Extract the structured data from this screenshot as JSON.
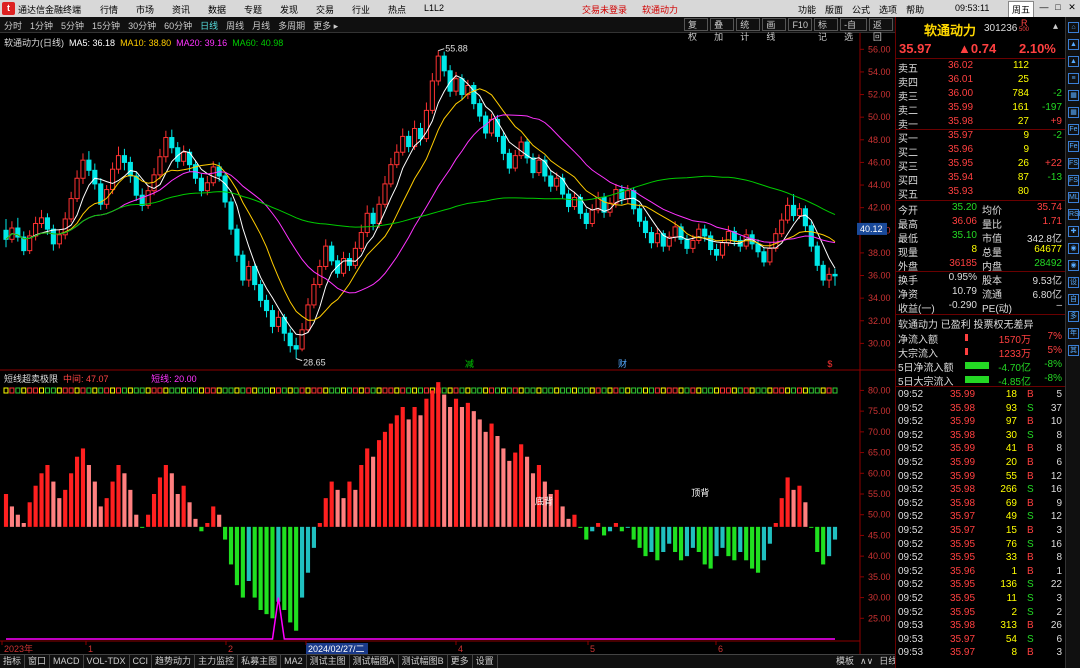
{
  "titlebar": {
    "logo": "t",
    "app": "通达信金融终端",
    "menu": [
      "行情",
      "市场",
      "资讯",
      "数据",
      "专题",
      "发现",
      "交易",
      "行业",
      "热点",
      "L1L2"
    ],
    "alert": "交易未登录",
    "alert2": "软通动力",
    "right": [
      "功能",
      "版面",
      "公式",
      "选项",
      "帮助"
    ],
    "clock": "09:53:11",
    "weekday": "周五",
    "window_buttons": [
      "—",
      "□",
      "✕"
    ]
  },
  "toolbar": {
    "tabs": [
      "分时",
      "1分钟",
      "5分钟",
      "15分钟",
      "30分钟",
      "60分钟",
      "日线",
      "周线",
      "月线",
      "多周期",
      "更多 ▸"
    ],
    "active": "日线",
    "right": [
      "复权",
      "叠加",
      "统计",
      "画线",
      "F10",
      "标记",
      "-自选",
      "返回"
    ]
  },
  "main_legend": {
    "name": "软通动力(日线)",
    "ma5": "MA5: 36.18",
    "ma10": "MA10: 38.80",
    "ma20": "MA20: 39.16",
    "ma60": "MA60: 40.98"
  },
  "sub_legend": {
    "name": "短线超卖极限",
    "mid": "中间: 47.07",
    "line": "短线: 20.00"
  },
  "chart_data": {
    "type": "candlestick",
    "y_axis_main": {
      "ticks": [
        56.0,
        54.0,
        52.0,
        50.0,
        48.0,
        46.0,
        44.0,
        42.0,
        40.0,
        38.0,
        36.0,
        34.0,
        32.0,
        30.0
      ],
      "range": [
        28.0,
        57.0
      ]
    },
    "y_axis_sub": {
      "ticks": [
        80.0,
        75.0,
        70.0,
        65.0,
        60.0,
        55.0,
        50.0,
        45.0,
        40.0,
        35.0,
        30.0,
        25.0
      ],
      "range": [
        20.0,
        83.0
      ]
    },
    "annotations": {
      "high": "55.88",
      "low": "28.65",
      "current_price_tag": "40.12",
      "sub_labels": [
        "底背",
        "顶背"
      ],
      "event_flags": [
        "减",
        "财",
        "$"
      ]
    },
    "x_axis_labels": [
      "2023年",
      "1",
      "2",
      "2024/02/27/二",
      "4",
      "5",
      "6"
    ],
    "bars": [
      [
        40.0,
        39.2,
        41.0,
        38.5
      ],
      [
        39.2,
        40.2,
        40.8,
        38.9
      ],
      [
        40.2,
        39.4,
        41.1,
        39.0
      ],
      [
        39.4,
        38.2,
        39.9,
        37.8
      ],
      [
        38.2,
        39.5,
        40.0,
        37.9
      ],
      [
        39.5,
        40.6,
        41.2,
        39.1
      ],
      [
        40.6,
        41.1,
        41.8,
        40.2
      ],
      [
        41.1,
        40.1,
        41.5,
        39.6
      ],
      [
        40.1,
        38.8,
        40.5,
        38.2
      ],
      [
        38.8,
        39.6,
        40.1,
        38.4
      ],
      [
        39.6,
        41.0,
        41.6,
        39.2
      ],
      [
        41.0,
        42.8,
        43.4,
        40.7
      ],
      [
        42.8,
        44.6,
        45.3,
        42.5
      ],
      [
        44.6,
        46.2,
        46.8,
        44.1
      ],
      [
        46.2,
        45.3,
        47.0,
        44.8
      ],
      [
        45.3,
        44.1,
        45.9,
        43.6
      ],
      [
        44.1,
        42.3,
        44.6,
        41.8
      ],
      [
        42.3,
        43.6,
        44.0,
        41.9
      ],
      [
        43.6,
        45.4,
        46.0,
        43.2
      ],
      [
        45.4,
        46.6,
        47.4,
        45.0
      ],
      [
        46.6,
        46.0,
        47.2,
        45.3
      ],
      [
        46.0,
        44.8,
        46.5,
        44.2
      ],
      [
        44.8,
        43.1,
        45.2,
        42.6
      ],
      [
        43.1,
        42.2,
        43.7,
        41.7
      ],
      [
        42.2,
        43.5,
        44.0,
        41.9
      ],
      [
        43.5,
        44.9,
        45.5,
        43.1
      ],
      [
        44.9,
        46.5,
        47.2,
        44.5
      ],
      [
        46.5,
        48.2,
        48.8,
        46.0
      ],
      [
        48.2,
        47.3,
        48.9,
        46.8
      ],
      [
        47.3,
        46.1,
        47.8,
        45.5
      ],
      [
        46.1,
        46.9,
        47.5,
        45.7
      ],
      [
        46.9,
        45.8,
        47.2,
        45.2
      ],
      [
        45.8,
        44.6,
        46.2,
        44.1
      ],
      [
        44.6,
        43.5,
        45.0,
        43.0
      ],
      [
        43.5,
        44.2,
        44.8,
        43.1
      ],
      [
        44.2,
        45.6,
        46.1,
        43.9
      ],
      [
        45.6,
        44.8,
        46.0,
        44.3
      ],
      [
        44.8,
        42.5,
        45.1,
        42.0
      ],
      [
        42.5,
        40.1,
        42.9,
        39.6
      ],
      [
        40.1,
        37.8,
        40.5,
        37.2
      ],
      [
        37.8,
        35.6,
        38.2,
        35.1
      ],
      [
        35.6,
        36.8,
        37.3,
        35.0
      ],
      [
        36.8,
        35.2,
        37.1,
        34.7
      ],
      [
        35.2,
        33.8,
        35.6,
        33.2
      ],
      [
        33.8,
        32.9,
        34.3,
        32.3
      ],
      [
        32.9,
        31.5,
        33.4,
        30.9
      ],
      [
        31.5,
        32.3,
        32.9,
        31.0
      ],
      [
        32.3,
        30.9,
        32.6,
        30.2
      ],
      [
        30.9,
        29.8,
        31.3,
        29.2
      ],
      [
        29.8,
        29.5,
        30.5,
        28.65
      ],
      [
        29.5,
        31.2,
        31.8,
        29.3
      ],
      [
        31.2,
        33.4,
        34.0,
        31.0
      ],
      [
        33.4,
        35.2,
        35.8,
        33.1
      ],
      [
        35.2,
        36.8,
        37.4,
        34.9
      ],
      [
        36.8,
        38.6,
        39.2,
        36.5
      ],
      [
        38.6,
        37.3,
        39.0,
        36.9
      ],
      [
        37.3,
        36.2,
        37.8,
        35.8
      ],
      [
        36.2,
        37.5,
        38.1,
        35.9
      ],
      [
        37.5,
        36.9,
        38.0,
        36.4
      ],
      [
        36.9,
        38.4,
        39.0,
        36.6
      ],
      [
        38.4,
        39.8,
        40.5,
        38.1
      ],
      [
        39.8,
        41.5,
        42.2,
        39.4
      ],
      [
        41.5,
        40.6,
        42.0,
        40.0
      ],
      [
        40.6,
        42.3,
        43.0,
        40.2
      ],
      [
        42.3,
        44.1,
        44.8,
        42.0
      ],
      [
        44.1,
        45.8,
        46.4,
        43.8
      ],
      [
        45.8,
        46.9,
        47.6,
        45.5
      ],
      [
        46.9,
        48.3,
        49.0,
        46.6
      ],
      [
        48.3,
        47.4,
        48.8,
        46.9
      ],
      [
        47.4,
        49.0,
        49.7,
        47.1
      ],
      [
        49.0,
        48.1,
        49.5,
        47.5
      ],
      [
        48.1,
        50.6,
        51.3,
        47.8
      ],
      [
        50.6,
        53.2,
        53.9,
        50.3
      ],
      [
        53.2,
        55.4,
        55.88,
        52.8
      ],
      [
        55.4,
        54.1,
        55.8,
        53.6
      ],
      [
        54.1,
        52.3,
        54.6,
        51.8
      ],
      [
        52.3,
        53.4,
        54.0,
        51.9
      ],
      [
        53.4,
        52.0,
        53.8,
        51.5
      ],
      [
        52.0,
        52.8,
        53.3,
        51.6
      ],
      [
        52.8,
        51.2,
        53.1,
        50.7
      ],
      [
        51.2,
        50.1,
        51.6,
        49.6
      ],
      [
        50.1,
        48.6,
        50.5,
        48.1
      ],
      [
        48.6,
        49.8,
        50.3,
        48.3
      ],
      [
        49.8,
        48.3,
        50.2,
        47.8
      ],
      [
        48.3,
        46.8,
        48.7,
        46.2
      ],
      [
        46.8,
        45.5,
        47.2,
        45.0
      ],
      [
        45.5,
        46.6,
        47.1,
        45.2
      ],
      [
        46.6,
        47.8,
        48.3,
        46.3
      ],
      [
        47.8,
        46.4,
        48.1,
        45.9
      ],
      [
        46.4,
        45.1,
        46.8,
        44.6
      ],
      [
        45.1,
        46.2,
        46.7,
        44.8
      ],
      [
        46.2,
        44.8,
        46.6,
        44.3
      ],
      [
        44.8,
        43.9,
        45.3,
        43.4
      ],
      [
        43.9,
        44.6,
        45.1,
        43.5
      ],
      [
        44.6,
        43.2,
        45.0,
        42.8
      ],
      [
        43.2,
        42.1,
        43.6,
        41.6
      ],
      [
        42.1,
        42.9,
        43.4,
        41.8
      ],
      [
        42.9,
        41.5,
        43.2,
        41.0
      ],
      [
        41.5,
        40.6,
        41.9,
        40.1
      ],
      [
        40.6,
        41.8,
        42.3,
        40.3
      ],
      [
        41.8,
        42.9,
        43.4,
        41.5
      ],
      [
        42.9,
        41.6,
        43.3,
        41.1
      ],
      [
        41.6,
        42.4,
        42.9,
        41.2
      ],
      [
        42.4,
        43.6,
        44.1,
        42.0
      ],
      [
        43.6,
        42.8,
        44.0,
        42.3
      ],
      [
        42.8,
        43.5,
        44.0,
        42.4
      ],
      [
        43.5,
        41.9,
        43.8,
        41.4
      ],
      [
        41.9,
        40.8,
        42.3,
        40.3
      ],
      [
        40.8,
        39.8,
        41.2,
        39.3
      ],
      [
        39.8,
        38.9,
        40.3,
        38.4
      ],
      [
        38.9,
        39.7,
        40.2,
        38.5
      ],
      [
        39.7,
        38.6,
        40.0,
        38.1
      ],
      [
        38.6,
        39.4,
        39.9,
        38.2
      ],
      [
        39.4,
        40.3,
        40.8,
        39.0
      ],
      [
        40.3,
        39.2,
        40.6,
        38.8
      ],
      [
        39.2,
        38.4,
        39.6,
        37.9
      ],
      [
        38.4,
        39.1,
        39.6,
        38.0
      ],
      [
        39.1,
        40.1,
        40.6,
        38.8
      ],
      [
        40.1,
        39.5,
        40.5,
        39.0
      ],
      [
        39.5,
        38.3,
        39.9,
        37.8
      ],
      [
        38.3,
        37.8,
        38.8,
        37.3
      ],
      [
        37.8,
        38.9,
        39.4,
        37.5
      ],
      [
        38.9,
        39.9,
        40.4,
        38.6
      ],
      [
        39.9,
        39.1,
        40.3,
        38.6
      ],
      [
        39.1,
        38.6,
        39.5,
        38.1
      ],
      [
        38.6,
        39.6,
        40.1,
        38.3
      ],
      [
        39.6,
        38.8,
        40.0,
        38.3
      ],
      [
        38.8,
        38.1,
        39.2,
        37.6
      ],
      [
        38.1,
        37.2,
        38.5,
        36.8
      ],
      [
        37.2,
        38.4,
        38.9,
        36.9
      ],
      [
        38.4,
        39.7,
        40.2,
        38.1
      ],
      [
        39.7,
        40.9,
        41.5,
        39.4
      ],
      [
        40.9,
        42.2,
        42.9,
        40.6
      ],
      [
        42.2,
        41.3,
        43.2,
        40.8
      ],
      [
        41.3,
        41.9,
        42.4,
        41.0
      ],
      [
        41.9,
        40.4,
        42.2,
        39.9
      ],
      [
        40.4,
        38.6,
        40.8,
        38.1
      ],
      [
        38.6,
        36.9,
        39.0,
        36.4
      ],
      [
        36.9,
        35.6,
        37.3,
        35.1
      ],
      [
        35.6,
        36.1,
        36.7,
        34.9
      ],
      [
        36.1,
        35.97,
        36.6,
        35.1
      ]
    ],
    "ma_lines": {
      "ma5": {
        "color": "#ffffff"
      },
      "ma10": {
        "color": "#ffcc00"
      },
      "ma20": {
        "color": "#ff33ff"
      },
      "ma60": {
        "color": "#00cc00"
      }
    },
    "oscillator": [
      55,
      52,
      50,
      48,
      53,
      57,
      60,
      62,
      58,
      54,
      56,
      60,
      64,
      66,
      62,
      58,
      52,
      54,
      58,
      62,
      60,
      56,
      50,
      47,
      50,
      55,
      59,
      62,
      60,
      55,
      57,
      53,
      49,
      46,
      48,
      52,
      50,
      44,
      38,
      33,
      30,
      34,
      30,
      27,
      26,
      25,
      29,
      27,
      24,
      22,
      30,
      36,
      42,
      48,
      54,
      58,
      56,
      54,
      58,
      56,
      62,
      66,
      64,
      68,
      70,
      72,
      74,
      76,
      73,
      76,
      74,
      78,
      80,
      82,
      79,
      76,
      78,
      76,
      77,
      75,
      73,
      70,
      72,
      69,
      66,
      63,
      65,
      67,
      64,
      60,
      62,
      58,
      55,
      56,
      52,
      49,
      50,
      47,
      44,
      46,
      48,
      45,
      46,
      48,
      46,
      47,
      44,
      42,
      40,
      41,
      39,
      41,
      43,
      41,
      39,
      40,
      42,
      41,
      38,
      37,
      40,
      42,
      40,
      39,
      41,
      39,
      37,
      36,
      39,
      43,
      48,
      54,
      59,
      56,
      57,
      53,
      47,
      41,
      38,
      40,
      44
    ],
    "tick_marks": "colored",
    "ref_line": 20.0
  },
  "quote": {
    "name": "软通动力",
    "code": "301236",
    "r_badge": "R",
    "r_sub": "500",
    "price": "35.97",
    "change": "▲0.74",
    "pct": "2.10%"
  },
  "order_book": {
    "asks": [
      [
        "卖五",
        "36.02",
        "112",
        ""
      ],
      [
        "卖四",
        "36.01",
        "25",
        ""
      ],
      [
        "卖三",
        "36.00",
        "784",
        "-2"
      ],
      [
        "卖二",
        "35.99",
        "161",
        "-197"
      ],
      [
        "卖一",
        "35.98",
        "27",
        "+9"
      ]
    ],
    "bids": [
      [
        "买一",
        "35.97",
        "9",
        "-2"
      ],
      [
        "买二",
        "35.96",
        "9",
        ""
      ],
      [
        "买三",
        "35.95",
        "26",
        "+22"
      ],
      [
        "买四",
        "35.94",
        "87",
        "-13"
      ],
      [
        "买五",
        "35.93",
        "80",
        ""
      ]
    ]
  },
  "stats": [
    [
      "今开",
      "35.20",
      "均价",
      "35.74"
    ],
    [
      "最高",
      "36.06",
      "量比",
      "1.71"
    ],
    [
      "最低",
      "35.10",
      "市值",
      "342.8亿"
    ],
    [
      "现量",
      "8",
      "总量",
      "64677"
    ],
    [
      "外盘",
      "36185",
      "内盘",
      "28492"
    ],
    [
      "换手",
      "0.95%",
      "股本",
      "9.53亿"
    ],
    [
      "净资",
      "10.79",
      "流通",
      "6.80亿"
    ],
    [
      "收益(一)",
      "-0.290",
      "PE(动)",
      "–"
    ]
  ],
  "tags": "软通动力 已盈利 投票权无差异",
  "flows": [
    [
      "净流入额",
      "1570万",
      "7%"
    ],
    [
      "大宗流入",
      "1233万",
      "5%"
    ],
    [
      "5日净流入额",
      "-4.70亿",
      "-8%"
    ],
    [
      "5日大宗流入",
      "-4.85亿",
      "-8%"
    ]
  ],
  "ticks": [
    [
      "09:52",
      "35.99",
      "18",
      "B",
      "5"
    ],
    [
      "09:52",
      "35.98",
      "93",
      "S",
      "37"
    ],
    [
      "09:52",
      "35.99",
      "97",
      "B",
      "10"
    ],
    [
      "09:52",
      "35.98",
      "30",
      "S",
      "8"
    ],
    [
      "09:52",
      "35.99",
      "41",
      "B",
      "8"
    ],
    [
      "09:52",
      "35.99",
      "20",
      "B",
      "6"
    ],
    [
      "09:52",
      "35.99",
      "55",
      "B",
      "12"
    ],
    [
      "09:52",
      "35.98",
      "266",
      "S",
      "16"
    ],
    [
      "09:52",
      "35.98",
      "69",
      "B",
      "9"
    ],
    [
      "09:52",
      "35.97",
      "49",
      "S",
      "12"
    ],
    [
      "09:52",
      "35.97",
      "15",
      "B",
      "3"
    ],
    [
      "09:52",
      "35.95",
      "76",
      "S",
      "16"
    ],
    [
      "09:52",
      "35.95",
      "33",
      "B",
      "8"
    ],
    [
      "09:52",
      "35.96",
      "1",
      "B",
      "1"
    ],
    [
      "09:52",
      "35.95",
      "136",
      "S",
      "22"
    ],
    [
      "09:52",
      "35.95",
      "11",
      "S",
      "3"
    ],
    [
      "09:52",
      "35.95",
      "2",
      "S",
      "2"
    ],
    [
      "09:53",
      "35.98",
      "313",
      "B",
      "26"
    ],
    [
      "09:53",
      "35.97",
      "54",
      "S",
      "6"
    ],
    [
      "09:53",
      "35.97",
      "8",
      "B",
      "3"
    ]
  ],
  "bottom_tabs": [
    "指标",
    "窗口",
    "MACD",
    "VOL-TDX",
    "CCI",
    "趋势动力",
    "主力监控",
    "私募主图",
    "MA2",
    "测试主图",
    "测试幅图A",
    "测试幅图B",
    "更多",
    "设置"
  ],
  "bottom_right": [
    "模板",
    "∧∨",
    "日线"
  ],
  "side_icons": [
    "⌂",
    "▲",
    "▲",
    "≡",
    "▦",
    "▦",
    "Fe",
    "Fe",
    "FS",
    "FS",
    "ML",
    "RSI",
    "✚",
    "◉",
    "◉",
    "设",
    "自",
    "多",
    "年",
    "其"
  ]
}
